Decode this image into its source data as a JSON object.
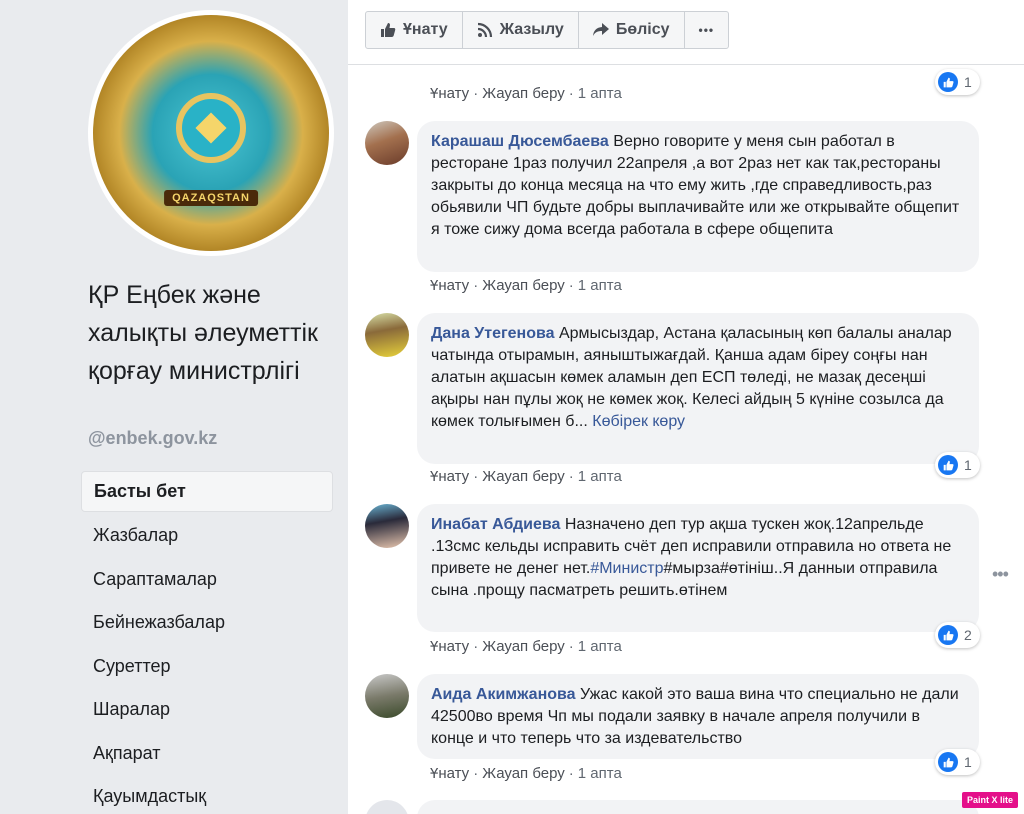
{
  "sidebar": {
    "logo_text": "QAZAQSTAN",
    "page_title": "ҚР Еңбек және халықты әлеуметтік қорғау министрлігі",
    "handle": "@enbek.gov.kz",
    "nav": [
      "Басты бет",
      "Жазбалар",
      "Сараптамалар",
      "Бейнежазбалар",
      "Суреттер",
      "Шаралар",
      "Ақпарат",
      "Қауымдастық"
    ]
  },
  "actions": {
    "like": "Ұнату",
    "subscribe": "Жазылу",
    "share": "Бөлісу",
    "more": "•••"
  },
  "meta_labels": {
    "like": "Ұнату",
    "reply": "Жауап беру",
    "separator": "·"
  },
  "comments": [
    {
      "author": "",
      "text": "",
      "time": "1 апта",
      "reactions": "1"
    },
    {
      "author": "Карашаш Дюсембаева",
      "text": "Верно говорите у меня сын работал в ресторане 1раз получил 22апреля ,а вот 2раз нет как так,рестораны закрыты до конца месяца на что ему жить ,где справедливость,раз обьявили ЧП будьте добры выплачивайте или же открывайте общепит я тоже сижу дома всегда работала в сфере общепита",
      "time": "1 апта"
    },
    {
      "author": "Дана Утегенова",
      "text": "Армысыздар, Астана қаласының көп балалы аналар чатында отырамын, аяныштыжағдай. Қанша адам біреу соңғы нан алатын ақшасын көмек аламын деп ЕСП төледі, не мазақ десеңші ақыры нан пұлы жоқ не көмек жоқ. Келесі айдың 5 күніне созылса да көмек толығымен б...",
      "see_more": "Көбірек көру",
      "time": "1 апта",
      "reactions": "1"
    },
    {
      "author": "Инабат Абдиева",
      "text_a": "Назначено деп тур ақша тускен жоқ.12апрельде .13смс кельды исправить счёт деп исправили отправила но ответа не привете не денег нет.",
      "hashtag": "#Министр",
      "text_b": "#мырза#өтініш..Я данныи отправила сына .прощу пасматреть решить.өтінем",
      "time": "1 апта",
      "reactions": "2"
    },
    {
      "author": "Аида Акимжанова",
      "text": "Ужас какой это ваша вина что специально не дали 42500во время Чп мы подали заявку в начале апреля получили в конце и что теперь что за издевательство",
      "time": "1 апта",
      "reactions": "1"
    }
  ],
  "overlay_badge": "Paint X lite",
  "colors": {
    "link_blue": "#385898",
    "like_blue": "#1877f2",
    "bubble_bg": "#f2f3f5",
    "sidebar_bg": "#e9ebee"
  }
}
